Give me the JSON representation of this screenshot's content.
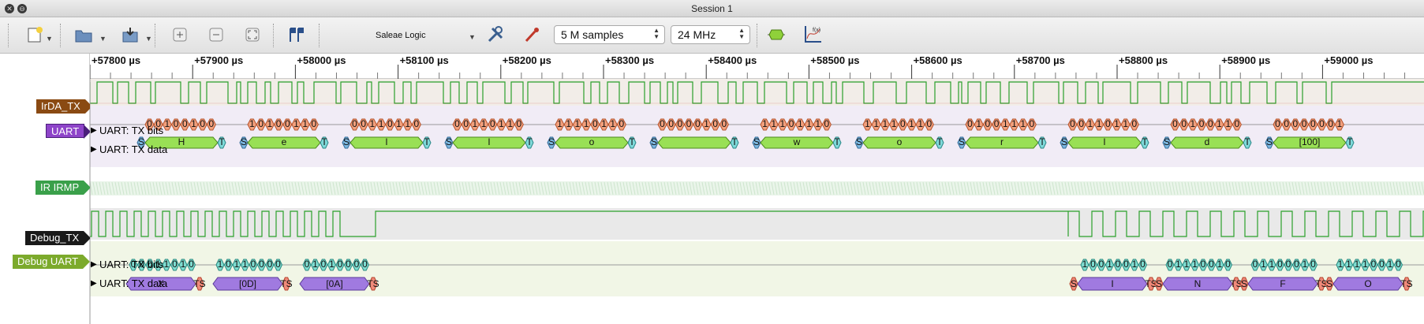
{
  "window": {
    "title": "Session 1"
  },
  "toolbar": {
    "device_name": "Saleae Logic",
    "samples": "5 M samples",
    "rate": "24 MHz"
  },
  "timeline": {
    "ticks": [
      "+57800 µs",
      "+57900 µs",
      "+58000 µs",
      "+58100 µs",
      "+58200 µs",
      "+58300 µs",
      "+58400 µs",
      "+58500 µs",
      "+58600 µs",
      "+58700 µs",
      "+58800 µs",
      "+58900 µs",
      "+59000 µs"
    ]
  },
  "channels": {
    "irda_tx": {
      "name": "IrDA_TX",
      "color": "#8a4a12"
    },
    "uart": {
      "name": "UART",
      "color": "#8e44c9"
    },
    "ir_irmp": {
      "name": "IR IRMP",
      "color": "#3aa04a"
    },
    "debug_tx": {
      "name": "Debug_TX",
      "color": "#1a1a1a"
    },
    "debug_uart": {
      "name": "Debug UART",
      "color": "#7caa2c"
    }
  },
  "analyzers": {
    "uart_bits_label": "UART: TX bits",
    "uart_data_label": "UART: TX data",
    "debug_bits_label": "UART: TX bits",
    "debug_data_label": "UART: TX data"
  },
  "uart_bytes": [
    {
      "bits": "00100100",
      "char": "H"
    },
    {
      "bits": "10100110",
      "char": "e"
    },
    {
      "bits": "00110110",
      "char": "l"
    },
    {
      "bits": "00110110",
      "char": "l"
    },
    {
      "bits": "11110110",
      "char": "o"
    },
    {
      "bits": "00000100",
      "char": ""
    },
    {
      "bits": "11101110",
      "char": "w"
    },
    {
      "bits": "11110110",
      "char": "o"
    },
    {
      "bits": "01001110",
      "char": "r"
    },
    {
      "bits": "00110110",
      "char": "l"
    },
    {
      "bits": "00100110",
      "char": "d"
    },
    {
      "bits": "00000001",
      "char": "[100]"
    }
  ],
  "debug_bytes_left": [
    {
      "bits": "00011010",
      "char": "X"
    },
    {
      "bits": "10110000",
      "char": "[0D]"
    },
    {
      "bits": "01010000",
      "char": "[0A]"
    }
  ],
  "debug_bytes_right": [
    {
      "bits": "10010010",
      "char": "I"
    },
    {
      "bits": "01110010",
      "char": "N"
    },
    {
      "bits": "01100010",
      "char": "F"
    },
    {
      "bits": "11110010",
      "char": "O"
    }
  ]
}
